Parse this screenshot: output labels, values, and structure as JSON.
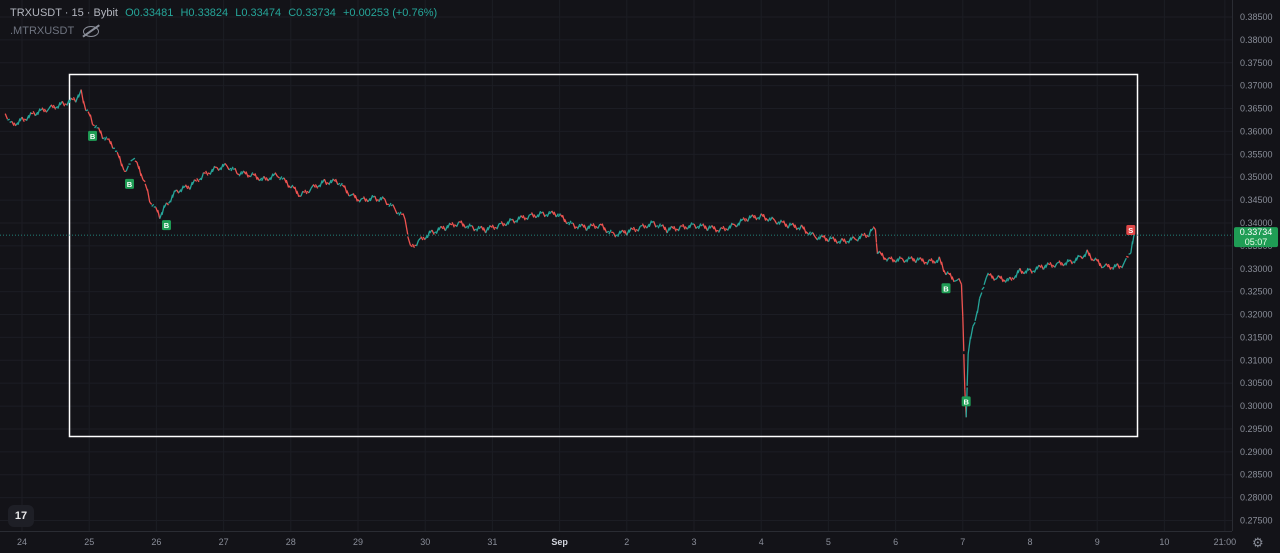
{
  "header": {
    "symbol": "TRXUSDT · 15 · Bybit",
    "open": "O0.33481",
    "high": "H0.33824",
    "low": "L0.33474",
    "close": "C0.33734",
    "change": "+0.00253 (+0.76%)",
    "indicator": ".MTRXUSDT"
  },
  "logo_text": "17",
  "price_tag": {
    "price": "0.33734",
    "countdown": "05:07"
  },
  "colors": {
    "bg": "#131318",
    "up": "#26a69a",
    "down": "#ef5350",
    "buy": "#1f9d55",
    "sell": "#e04848",
    "box": "#ffffff"
  },
  "chart_data": {
    "type": "line",
    "title": "",
    "xlabel": "",
    "ylabel": "",
    "ylim": [
      0.2725,
      0.3875
    ],
    "y_ticks": [
      "0.38500",
      "0.38000",
      "0.37500",
      "0.37000",
      "0.36500",
      "0.36000",
      "0.35500",
      "0.35000",
      "0.34500",
      "0.34000",
      "0.33500",
      "0.33000",
      "0.32500",
      "0.32000",
      "0.31500",
      "0.31000",
      "0.30500",
      "0.30000",
      "0.29500",
      "0.29000",
      "0.28500",
      "0.28000",
      "0.27500"
    ],
    "x_ticks": [
      {
        "label": "24",
        "x": 0
      },
      {
        "label": "25",
        "x": 1
      },
      {
        "label": "26",
        "x": 2
      },
      {
        "label": "27",
        "x": 3
      },
      {
        "label": "28",
        "x": 4
      },
      {
        "label": "29",
        "x": 5
      },
      {
        "label": "30",
        "x": 6
      },
      {
        "label": "31",
        "x": 7
      },
      {
        "label": "Sep",
        "x": 8
      },
      {
        "label": "2",
        "x": 9
      },
      {
        "label": "3",
        "x": 10
      },
      {
        "label": "4",
        "x": 11
      },
      {
        "label": "5",
        "x": 12
      },
      {
        "label": "6",
        "x": 13
      },
      {
        "label": "7",
        "x": 14
      },
      {
        "label": "8",
        "x": 15
      },
      {
        "label": "9",
        "x": 16
      },
      {
        "label": "10",
        "x": 17
      },
      {
        "label": "21:00",
        "x": 17.9
      }
    ],
    "series": [
      {
        "values": [
          [
            -0.25,
            0.364
          ],
          [
            -0.15,
            0.3615
          ],
          [
            0.0,
            0.3625
          ],
          [
            0.2,
            0.364
          ],
          [
            0.4,
            0.365
          ],
          [
            0.6,
            0.366
          ],
          [
            0.8,
            0.367
          ],
          [
            0.88,
            0.3685
          ],
          [
            0.95,
            0.365
          ],
          [
            1.05,
            0.362
          ],
          [
            1.2,
            0.359
          ],
          [
            1.35,
            0.357
          ],
          [
            1.55,
            0.351
          ],
          [
            1.65,
            0.3545
          ],
          [
            1.8,
            0.35
          ],
          [
            1.9,
            0.345
          ],
          [
            2.05,
            0.3415
          ],
          [
            2.15,
            0.344
          ],
          [
            2.3,
            0.347
          ],
          [
            2.5,
            0.348
          ],
          [
            2.7,
            0.3505
          ],
          [
            2.9,
            0.352
          ],
          [
            3.05,
            0.3525
          ],
          [
            3.2,
            0.351
          ],
          [
            3.4,
            0.3505
          ],
          [
            3.6,
            0.3495
          ],
          [
            3.8,
            0.3505
          ],
          [
            4.0,
            0.348
          ],
          [
            4.15,
            0.346
          ],
          [
            4.3,
            0.3475
          ],
          [
            4.5,
            0.349
          ],
          [
            4.7,
            0.349
          ],
          [
            4.9,
            0.346
          ],
          [
            5.05,
            0.345
          ],
          [
            5.25,
            0.3455
          ],
          [
            5.4,
            0.345
          ],
          [
            5.55,
            0.343
          ],
          [
            5.7,
            0.341
          ],
          [
            5.78,
            0.3345
          ],
          [
            5.9,
            0.336
          ],
          [
            6.1,
            0.338
          ],
          [
            6.3,
            0.339
          ],
          [
            6.5,
            0.34
          ],
          [
            6.7,
            0.339
          ],
          [
            6.9,
            0.3385
          ],
          [
            7.1,
            0.3395
          ],
          [
            7.3,
            0.3405
          ],
          [
            7.55,
            0.3415
          ],
          [
            7.75,
            0.342
          ],
          [
            7.95,
            0.342
          ],
          [
            8.2,
            0.3395
          ],
          [
            8.4,
            0.339
          ],
          [
            8.6,
            0.3395
          ],
          [
            8.8,
            0.3375
          ],
          [
            9.0,
            0.338
          ],
          [
            9.2,
            0.339
          ],
          [
            9.4,
            0.34
          ],
          [
            9.6,
            0.3385
          ],
          [
            9.8,
            0.339
          ],
          [
            10.0,
            0.3395
          ],
          [
            10.2,
            0.339
          ],
          [
            10.4,
            0.3385
          ],
          [
            10.6,
            0.3395
          ],
          [
            10.8,
            0.341
          ],
          [
            11.0,
            0.3415
          ],
          [
            11.2,
            0.3405
          ],
          [
            11.4,
            0.3395
          ],
          [
            11.6,
            0.339
          ],
          [
            11.8,
            0.337
          ],
          [
            12.0,
            0.3365
          ],
          [
            12.2,
            0.336
          ],
          [
            12.4,
            0.3365
          ],
          [
            12.6,
            0.3375
          ],
          [
            12.7,
            0.339
          ],
          [
            12.73,
            0.3335
          ],
          [
            12.9,
            0.332
          ],
          [
            13.1,
            0.332
          ],
          [
            13.3,
            0.332
          ],
          [
            13.5,
            0.3315
          ],
          [
            13.65,
            0.332
          ],
          [
            13.75,
            0.329
          ],
          [
            13.9,
            0.3275
          ],
          [
            13.98,
            0.327
          ],
          [
            14.0,
            0.32
          ],
          [
            14.03,
            0.303
          ],
          [
            14.05,
            0.2975
          ],
          [
            14.08,
            0.312
          ],
          [
            14.15,
            0.317
          ],
          [
            14.25,
            0.323
          ],
          [
            14.35,
            0.3285
          ],
          [
            14.5,
            0.328
          ],
          [
            14.7,
            0.3275
          ],
          [
            14.85,
            0.3295
          ],
          [
            15.0,
            0.3295
          ],
          [
            15.2,
            0.3305
          ],
          [
            15.4,
            0.331
          ],
          [
            15.6,
            0.3315
          ],
          [
            15.75,
            0.3325
          ],
          [
            15.85,
            0.3335
          ],
          [
            15.95,
            0.332
          ],
          [
            16.1,
            0.3305
          ],
          [
            16.3,
            0.3305
          ],
          [
            16.4,
            0.331
          ],
          [
            16.5,
            0.334
          ],
          [
            16.55,
            0.337
          ]
        ]
      }
    ],
    "markers": [
      {
        "label": "B",
        "x": 1.05,
        "y": 0.361,
        "side": "below"
      },
      {
        "label": "B",
        "x": 1.6,
        "y": 0.3505,
        "side": "below"
      },
      {
        "label": "B",
        "x": 2.15,
        "y": 0.3415,
        "side": "below"
      },
      {
        "label": "B",
        "x": 13.75,
        "y": 0.3277,
        "side": "below"
      },
      {
        "label": "B",
        "x": 14.05,
        "y": 0.303,
        "side": "below"
      },
      {
        "label": "S",
        "x": 16.5,
        "y": 0.3365,
        "side": "above"
      }
    ],
    "current_price": 0.33734,
    "grid": true
  }
}
